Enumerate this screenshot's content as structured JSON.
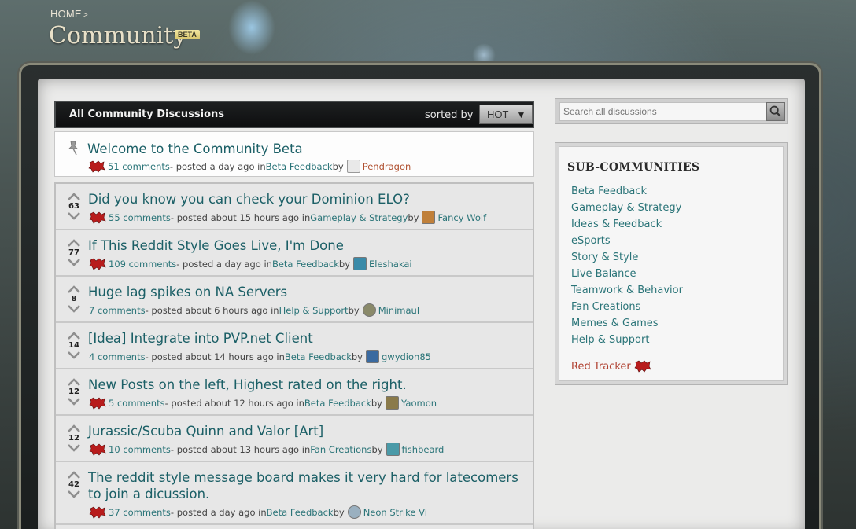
{
  "header": {
    "breadcrumb_home": "HOME",
    "breadcrumb_sep": ">",
    "title": "Community",
    "badge": "BETA"
  },
  "discussions": {
    "header_title": "All Community Discussions",
    "sorted_label": "sorted by",
    "sort_value": "HOT",
    "sticky": {
      "title": "Welcome to the Community Beta",
      "comments": "51 comments",
      "posted": " - posted a day ago in ",
      "category": "Beta Feedback",
      "by": " by ",
      "author": "Pendragon"
    },
    "rows": [
      {
        "score": "63",
        "title": "Did you know you can check your Dominion ELO?",
        "comments": "55 comments",
        "posted": " - posted about 15 hours ago in ",
        "category": "Gameplay & Strategy",
        "by": " by ",
        "author": "Fancy Wolf"
      },
      {
        "score": "77",
        "title": "If This Reddit Style Goes Live, I'm Done",
        "comments": "109 comments",
        "posted": " - posted a day ago in ",
        "category": "Beta Feedback",
        "by": " by ",
        "author": "Eleshakai"
      },
      {
        "score": "8",
        "title": "Huge lag spikes on NA Servers",
        "comments": "7 comments",
        "posted": " - posted about 6 hours ago in ",
        "category": "Help & Support",
        "by": " by ",
        "author": "Minimaul"
      },
      {
        "score": "14",
        "title": "[Idea] Integrate into PVP.net Client",
        "comments": "4 comments",
        "posted": " - posted about 14 hours ago in ",
        "category": "Beta Feedback",
        "by": " by ",
        "author": "gwydion85"
      },
      {
        "score": "12",
        "title": "New Posts on the left, Highest rated on the right.",
        "comments": "5 comments",
        "posted": " - posted about 12 hours ago in ",
        "category": "Beta Feedback",
        "by": " by ",
        "author": "Yaomon"
      },
      {
        "score": "12",
        "title": "Jurassic/Scuba Quinn and Valor [Art]",
        "comments": "10 comments",
        "posted": " - posted about 13 hours ago in ",
        "category": "Fan Creations",
        "by": " by ",
        "author": "fishbeard"
      },
      {
        "score": "42",
        "title": "The reddit style message board makes it very hard for latecomers to join a dicussion.",
        "comments": "37 comments",
        "posted": " - posted a day ago in ",
        "category": "Beta Feedback",
        "by": " by ",
        "author": "Neon Strike Vi"
      }
    ]
  },
  "sidebar": {
    "search_placeholder": "Search all discussions",
    "sub_heading": "SUB-COMMUNITIES",
    "links": [
      "Beta Feedback",
      "Gameplay & Strategy",
      "Ideas & Feedback",
      "eSports",
      "Story & Style",
      "Live Balance",
      "Teamwork & Behavior",
      "Fan Creations",
      "Memes & Games",
      "Help & Support"
    ],
    "red_tracker": "Red Tracker"
  },
  "colors": {
    "link": "#2a7478",
    "title": "#1b5f66",
    "red": "#b04030"
  }
}
